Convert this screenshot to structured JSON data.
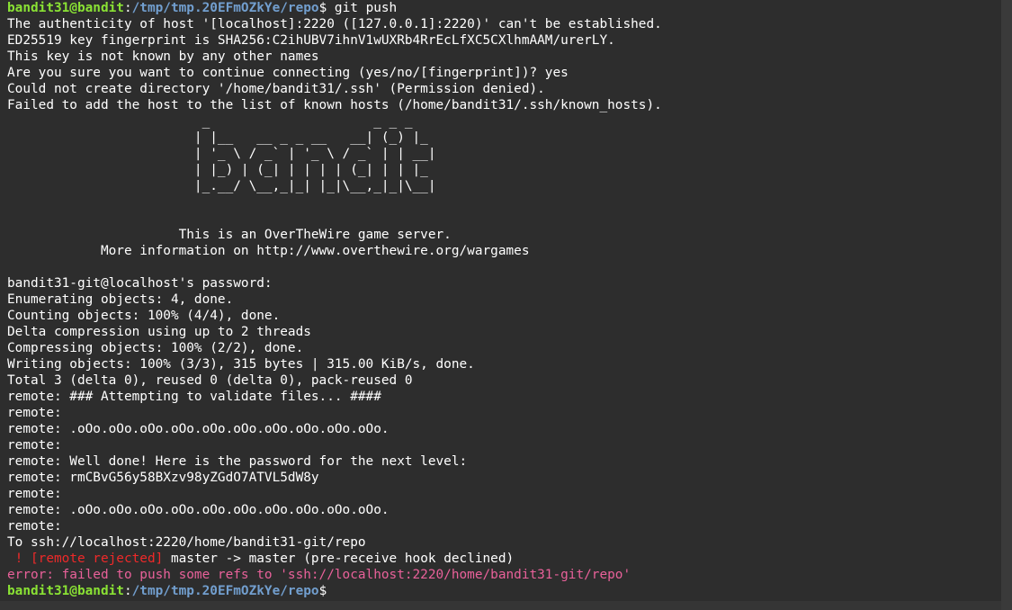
{
  "colors": {
    "background": "#2d2d2d",
    "text": "#ffffff",
    "prompt_user": "#8ae234",
    "prompt_path": "#729fcf",
    "rejected": "#ef2929",
    "error": "#e9619a"
  },
  "prompt": {
    "user_host": "bandit31@bandit",
    "separator": ":",
    "path": "/tmp/tmp.20EFmOZkYe/repo",
    "symbol": "$"
  },
  "command": " git push",
  "output": [
    "The authenticity of host '[localhost]:2220 ([127.0.0.1]:2220)' can't be established.",
    "ED25519 key fingerprint is SHA256:C2ihUBV7ihnV1wUXRb4RrEcLfXC5CXlhmAAM/urerLY.",
    "This key is not known by any other names",
    "Are you sure you want to continue connecting (yes/no/[fingerprint])? yes",
    "Could not create directory '/home/bandit31/.ssh' (Permission denied).",
    "Failed to add the host to the list of known hosts (/home/bandit31/.ssh/known_hosts).",
    "                         _                     _ _ _   ",
    "                        | |__   __ _ _ __   __| (_) |_ ",
    "                        | '_ \\ / _` | '_ \\ / _` | | __|",
    "                        | |_) | (_| | | | | (_| | | |_ ",
    "                        |_.__/ \\__,_|_| |_|\\__,_|_|\\__|",
    "",
    "",
    "                      This is an OverTheWire game server.",
    "            More information on http://www.overthewire.org/wargames",
    "",
    "bandit31-git@localhost's password:",
    "Enumerating objects: 4, done.",
    "Counting objects: 100% (4/4), done.",
    "Delta compression using up to 2 threads",
    "Compressing objects: 100% (2/2), done.",
    "Writing objects: 100% (3/3), 315 bytes | 315.00 KiB/s, done.",
    "Total 3 (delta 0), reused 0 (delta 0), pack-reused 0",
    "remote: ### Attempting to validate files... ####",
    "remote:",
    "remote: .oOo.oOo.oOo.oOo.oOo.oOo.oOo.oOo.oOo.oOo.",
    "remote:",
    "remote: Well done! Here is the password for the next level:",
    "remote: rmCBvG56y58BXzv98yZGdO7ATVL5dW8y",
    "remote:",
    "remote: .oOo.oOo.oOo.oOo.oOo.oOo.oOo.oOo.oOo.oOo.",
    "remote:",
    "To ssh://localhost:2220/home/bandit31-git/repo"
  ],
  "rejected": {
    "prefix": " ! ",
    "label": "[remote rejected]",
    "rest": " master -> master (pre-receive hook declined)"
  },
  "error_line": "error: failed to push some refs to 'ssh://localhost:2220/home/bandit31-git/repo'"
}
